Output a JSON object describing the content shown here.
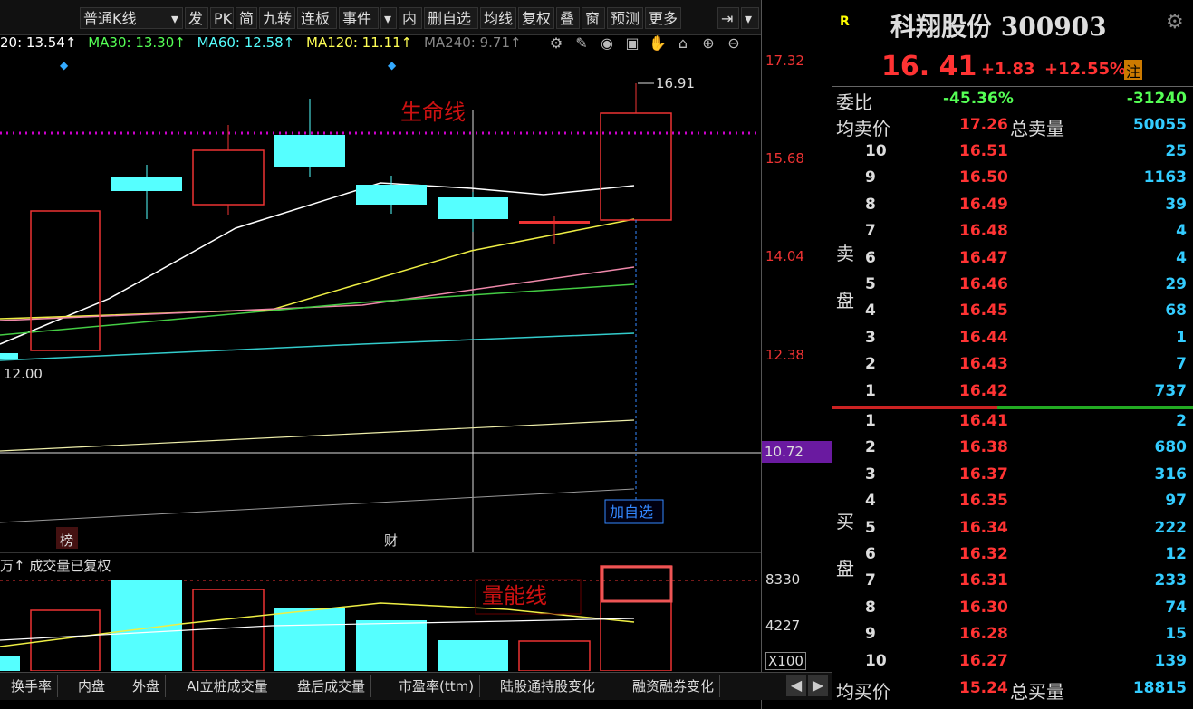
{
  "toolbar": {
    "kline_select": "普通K线",
    "buttons": [
      "发",
      "PK",
      "简",
      "九转",
      "连板",
      "事件",
      "内",
      "删自选",
      "均线",
      "复权",
      "叠",
      "窗",
      "预测",
      "更多"
    ]
  },
  "ma": {
    "ma20": "20: 13.54↑",
    "ma30": "MA30: 13.30↑",
    "ma60": "MA60: 12.58↑",
    "ma120": "MA120: 11.11↑",
    "ma240": "MA240: 9.71↑"
  },
  "chart": {
    "annotation_life": "生命线",
    "annotation_volume": "量能线",
    "high_label": "16.91",
    "low_label": "12.00",
    "marker_bang": "榜",
    "marker_cai": "财",
    "add_watch": "加自选",
    "volume_title": "万↑ 成交量已复权",
    "price_labels": [
      "17.32",
      "15.68",
      "14.04",
      "12.38"
    ],
    "current_axis_label": "10.72",
    "vol_labels": [
      "8330",
      "4227",
      "X100"
    ]
  },
  "bottom_tabs": [
    "换手率",
    "内盘",
    "外盘",
    "AI立桩成交量",
    "盘后成交量",
    "市盈率(ttm)",
    "陆股通持股变化",
    "融资融券变化"
  ],
  "stock": {
    "badge": "R",
    "title": "科翔股份 300903",
    "price": "16. 41",
    "change": "+1.83",
    "change_pct": "+12.55%",
    "note_badge": "注"
  },
  "quote": {
    "weibi_label": "委比",
    "weibi_pct": "-45.36%",
    "weibi_val": "-31240",
    "avg_sell_label": "均卖价",
    "avg_sell": "17.26",
    "total_sell_label": "总卖量",
    "total_sell": "50055",
    "sell_side_label_1": "卖",
    "sell_side_label_2": "盘",
    "buy_side_label_1": "买",
    "buy_side_label_2": "盘",
    "avg_buy_label": "均买价",
    "avg_buy": "15.24",
    "total_buy_label": "总买量",
    "total_buy": "18815"
  },
  "sell_levels": [
    {
      "lvl": "10",
      "price": "16.51",
      "vol": "25"
    },
    {
      "lvl": "9",
      "price": "16.50",
      "vol": "1163"
    },
    {
      "lvl": "8",
      "price": "16.49",
      "vol": "39"
    },
    {
      "lvl": "7",
      "price": "16.48",
      "vol": "4"
    },
    {
      "lvl": "6",
      "price": "16.47",
      "vol": "4"
    },
    {
      "lvl": "5",
      "price": "16.46",
      "vol": "29"
    },
    {
      "lvl": "4",
      "price": "16.45",
      "vol": "68"
    },
    {
      "lvl": "3",
      "price": "16.44",
      "vol": "1"
    },
    {
      "lvl": "2",
      "price": "16.43",
      "vol": "7"
    },
    {
      "lvl": "1",
      "price": "16.42",
      "vol": "737"
    }
  ],
  "buy_levels": [
    {
      "lvl": "1",
      "price": "16.41",
      "vol": "2"
    },
    {
      "lvl": "2",
      "price": "16.38",
      "vol": "680"
    },
    {
      "lvl": "3",
      "price": "16.37",
      "vol": "316"
    },
    {
      "lvl": "4",
      "price": "16.35",
      "vol": "97"
    },
    {
      "lvl": "5",
      "price": "16.34",
      "vol": "222"
    },
    {
      "lvl": "6",
      "price": "16.32",
      "vol": "12"
    },
    {
      "lvl": "7",
      "price": "16.31",
      "vol": "233"
    },
    {
      "lvl": "8",
      "price": "16.30",
      "vol": "74"
    },
    {
      "lvl": "9",
      "price": "16.28",
      "vol": "15"
    },
    {
      "lvl": "10",
      "price": "16.27",
      "vol": "139"
    }
  ],
  "colors": {
    "up": "#ff3333",
    "down": "#55ffff",
    "accent": "#cc00cc"
  }
}
